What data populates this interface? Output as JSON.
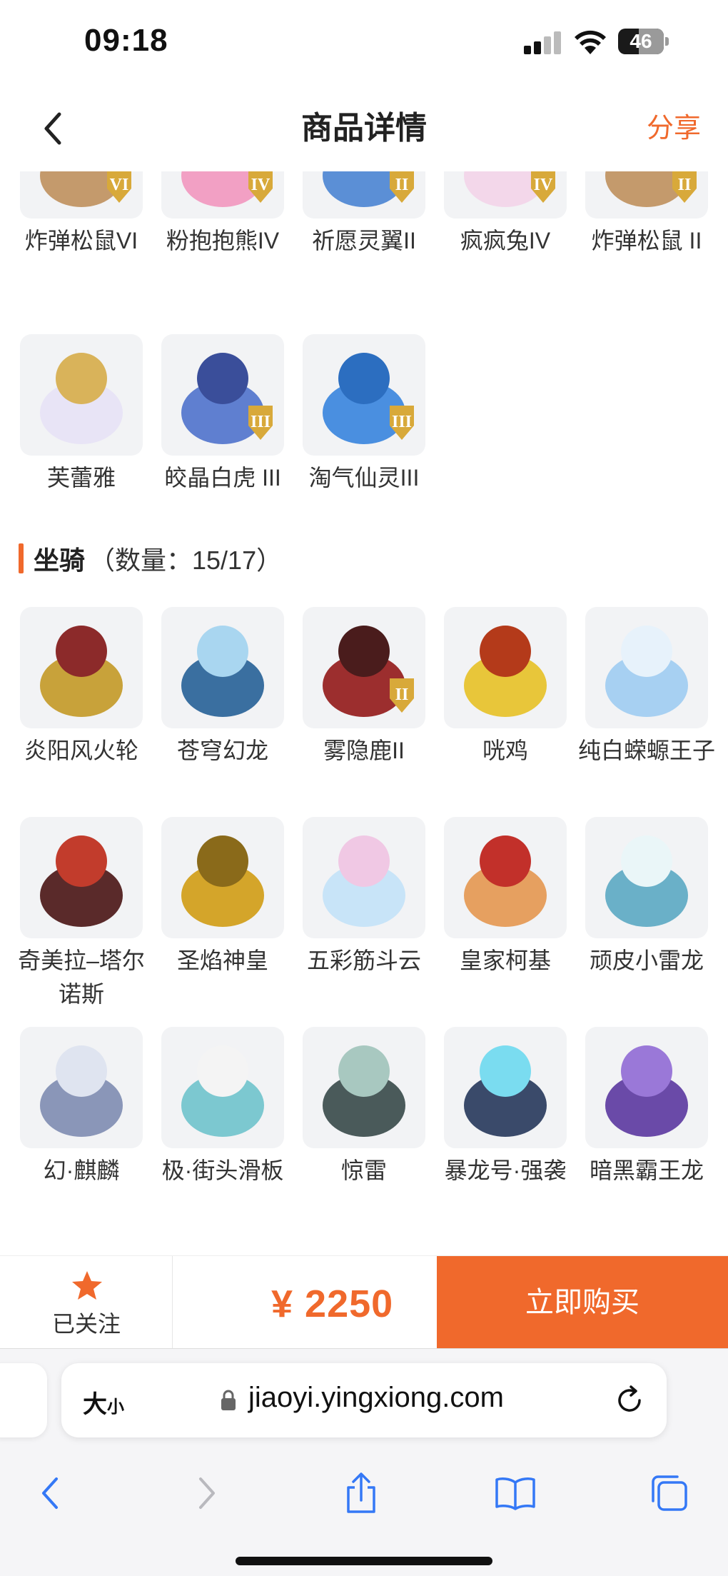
{
  "status_bar": {
    "time": "09:18",
    "battery": "46",
    "battery_fraction": 0.46
  },
  "nav": {
    "title": "商品详情",
    "share": "分享"
  },
  "pets_section": {
    "row1": [
      {
        "name": "炸弹松鼠VI",
        "badge": "VI"
      },
      {
        "name": "粉抱抱熊IV",
        "badge": "IV"
      },
      {
        "name": "祈愿灵翼II",
        "badge": "II"
      },
      {
        "name": "疯疯兔IV",
        "badge": "IV"
      },
      {
        "name": "炸弹松鼠 II",
        "badge": "II"
      }
    ],
    "row2": [
      {
        "name": "芙蕾雅",
        "badge": ""
      },
      {
        "name": "皎晶白虎 III",
        "badge": "III"
      },
      {
        "name": "淘气仙灵III",
        "badge": "III"
      }
    ]
  },
  "mounts_section": {
    "title": "坐骑",
    "count": "（数量：15/17）",
    "items": [
      {
        "name": "炎阳风火轮",
        "badge": ""
      },
      {
        "name": "苍穹幻龙",
        "badge": ""
      },
      {
        "name": "雾隐鹿II",
        "badge": "II"
      },
      {
        "name": "咣鸡",
        "badge": ""
      },
      {
        "name": "纯白蝾螈王子",
        "badge": ""
      },
      {
        "name": "奇美拉–塔尔诺斯",
        "badge": ""
      },
      {
        "name": "圣焰神皇",
        "badge": ""
      },
      {
        "name": "五彩筋斗云",
        "badge": ""
      },
      {
        "name": "皇家柯基",
        "badge": ""
      },
      {
        "name": "顽皮小雷龙",
        "badge": ""
      },
      {
        "name": "幻·麒麟",
        "badge": ""
      },
      {
        "name": "极·街头滑板",
        "badge": ""
      },
      {
        "name": "惊雷",
        "badge": ""
      },
      {
        "name": "暴龙号·强袭",
        "badge": ""
      },
      {
        "name": "暗黑霸王龙",
        "badge": ""
      }
    ]
  },
  "bottom_bar": {
    "follow_label": "已关注",
    "price": "¥ 2250",
    "buy_label": "立即购买"
  },
  "browser": {
    "text_size": "大",
    "text_size_small": "小",
    "url": "jiaoyi.yingxiong.com"
  },
  "colors": {
    "accent": "#f0692c",
    "thumb_bg": "#f2f3f5",
    "safari_blue": "#3478f6"
  }
}
